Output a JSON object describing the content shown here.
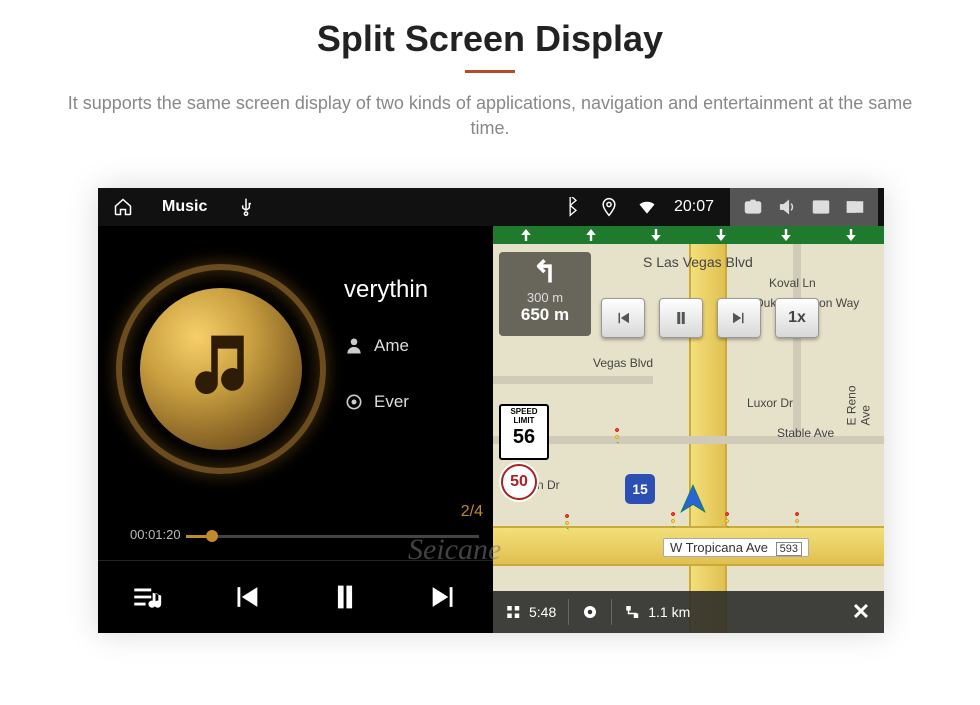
{
  "page": {
    "title": "Split Screen Display",
    "subtitle": "It supports the same screen display of two kinds of applications, navigation and entertainment at the same time."
  },
  "statusbar": {
    "app_label": "Music",
    "clock": "20:07"
  },
  "music": {
    "track1": "verythin",
    "track2": "Ame",
    "track3": "Ever",
    "counter": "2/4",
    "elapsed": "00:01:20"
  },
  "nav": {
    "turn_primary": "300 m",
    "turn_secondary": "650 m",
    "street_top": "S Las Vegas Blvd",
    "poi_koval": "Koval Ln",
    "poi_duke": "Duke Ellington Way",
    "poi_vegas": "Vegas Blvd",
    "poi_luxor": "Luxor Dr",
    "poi_stable": "Stable Ave",
    "poi_reno": "E Reno Ave",
    "poi_rtin": "rtin Dr",
    "speed_label": "SPEED LIMIT",
    "speed_value": "56",
    "hwy_50": "50",
    "hwy_15": "15",
    "sim_speed": "1x",
    "street_bottom": "W Tropicana Ave",
    "street_bottom_code": "593",
    "eta": "5:48",
    "dist": "1.1 km"
  },
  "watermark": "Seicane"
}
